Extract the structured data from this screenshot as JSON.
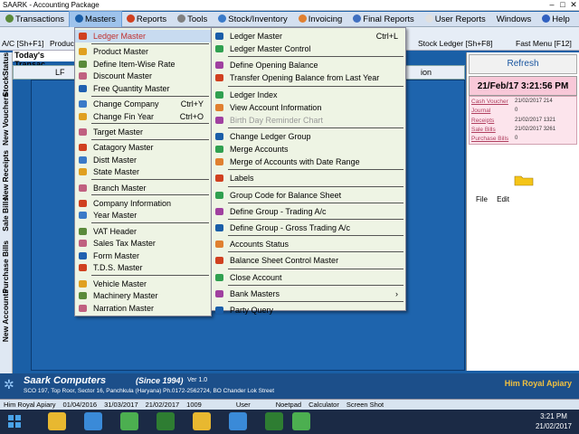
{
  "window": {
    "title": "SAARK - Accounting Package"
  },
  "menubar": [
    {
      "label": "Transactions",
      "color": "#5a8a3a"
    },
    {
      "label": "Masters",
      "color": "#1a5ea8"
    },
    {
      "label": "Reports",
      "color": "#d04020"
    },
    {
      "label": "Tools",
      "color": "#808080"
    },
    {
      "label": "Stock/Inventory",
      "color": "#3a7ac8"
    },
    {
      "label": "Invoicing",
      "color": "#e08030"
    },
    {
      "label": "Final Reports",
      "color": "#4070c0"
    },
    {
      "label": "User Reports",
      "color": "#e0e0e0"
    },
    {
      "label": "Windows",
      "color": ""
    },
    {
      "label": "Help",
      "color": "#3060c0"
    }
  ],
  "toolbar": {
    "left1": "A/C [Sh+F1]",
    "left2": "Produc",
    "right1": "Stock Ledger [Sh+F8]",
    "right2": "Fast Menu [F12]"
  },
  "left_tabs": [
    "StockStatus",
    "New Vouchers",
    "New Receipts",
    "Sale Bills",
    "Purchase Bills",
    "New Accounts"
  ],
  "todays": "Today's Transac",
  "grid": {
    "col1": "LF",
    "col_right": "ion"
  },
  "right_panel": {
    "refresh": "Refresh",
    "datetime": "21/Feb/17 3:21:56 PM",
    "last_entries": [
      {
        "label": "Cash Voucher",
        "value": "21/02/2017 214"
      },
      {
        "label": "Journal",
        "value": "0"
      },
      {
        "label": "Receipts",
        "value": "21/02/2017 1321"
      },
      {
        "label": "Sale Bills",
        "value": "21/02/2017 3261"
      },
      {
        "label": "Purchase Bills",
        "value": "0"
      }
    ],
    "file_menu": [
      "File",
      "Edit"
    ]
  },
  "masters_menu": {
    "items": [
      {
        "label": "Ledger Master",
        "shortcut": "",
        "highlight": true
      },
      {
        "sep": true
      },
      {
        "label": "Product Master"
      },
      {
        "label": "Define Item-Wise Rate"
      },
      {
        "label": "Discount Master"
      },
      {
        "label": "Free Quantity Master"
      },
      {
        "sep": true
      },
      {
        "label": "Change Company",
        "shortcut": "Ctrl+Y"
      },
      {
        "label": "Change Fin Year",
        "shortcut": "Ctrl+O"
      },
      {
        "sep": true
      },
      {
        "label": "Target Master"
      },
      {
        "sep": true
      },
      {
        "label": "Catagory Master"
      },
      {
        "label": "Distt Master"
      },
      {
        "label": "State Master"
      },
      {
        "sep": true
      },
      {
        "label": "Branch Master"
      },
      {
        "sep": true
      },
      {
        "label": "Company Information"
      },
      {
        "label": "Year Master"
      },
      {
        "sep": true
      },
      {
        "label": "VAT Header"
      },
      {
        "label": "Sales Tax  Master"
      },
      {
        "label": "Form Master"
      },
      {
        "label": "T.D.S. Master"
      },
      {
        "sep": true
      },
      {
        "label": "Vehicle Master"
      },
      {
        "label": "Machinery Master"
      },
      {
        "label": "Narration Master"
      }
    ]
  },
  "ledger_submenu": {
    "items": [
      {
        "label": "Ledger Master",
        "shortcut": "Ctrl+L"
      },
      {
        "label": "Ledger Master Control"
      },
      {
        "sep": true
      },
      {
        "label": "Define Opening Balance"
      },
      {
        "label": "Transfer Opening Balance from Last Year"
      },
      {
        "sep": true
      },
      {
        "label": "Ledger Index"
      },
      {
        "label": "View Account Information"
      },
      {
        "label": "Birth Day Reminder Chart",
        "dim": true
      },
      {
        "sep": true
      },
      {
        "label": "Change Ledger Group"
      },
      {
        "label": "Merge Accounts"
      },
      {
        "label": "Merge of Accounts with Date Range"
      },
      {
        "sep": true
      },
      {
        "label": "Labels"
      },
      {
        "sep": true
      },
      {
        "label": "Group Code for Balance Sheet"
      },
      {
        "sep": true
      },
      {
        "label": "Define Group - Trading A/c"
      },
      {
        "sep": true
      },
      {
        "label": "Define Group - Gross Trading A/c"
      },
      {
        "sep": true
      },
      {
        "label": "Accounts Status"
      },
      {
        "sep": true
      },
      {
        "label": "Balance Sheet Control Master"
      },
      {
        "sep": true
      },
      {
        "label": "Close Account"
      },
      {
        "sep": true
      },
      {
        "label": "Bank Masters",
        "submenu": true
      },
      {
        "sep": true
      },
      {
        "label": "Party Query"
      }
    ]
  },
  "footer": {
    "company": "Saark Computers",
    "since": "(Since 1994)",
    "ver": "Ver 1.0",
    "address": "SCO 197, Top Roor, Sector 16, Panchkula (Haryana) Ph.0172-2562724,  BO Chander Lok Street",
    "right": "Him Royal Apiary"
  },
  "status": {
    "company": "Him Royal Apiary",
    "from": "01/04/2016",
    "to": "31/03/2017",
    "date": "21/02/2017",
    "num": "1009",
    "user": "User",
    "notepad": "Noetpad",
    "calculator": "Calculator",
    "screenshot": "Screen Shot"
  },
  "clock": {
    "time": "3:21 PM",
    "date": "21/02/2017"
  },
  "taskbar_colors": [
    "#e8b830",
    "#3a8ad8",
    "#4caf50",
    "#2e7d32",
    "#e8b830",
    "#3a8ad8",
    "#2e7d32",
    "#4caf50"
  ]
}
